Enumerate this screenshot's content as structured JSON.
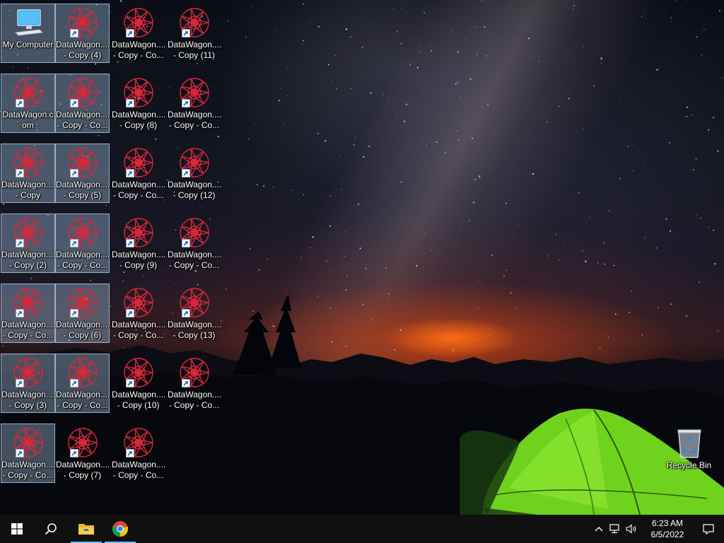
{
  "desktop": {
    "wallpaper": "night sky with milky way, sunset glow over mountains, illuminated green tent",
    "icons": [
      {
        "kind": "computer",
        "l1": "My Computer",
        "l2": "",
        "sel": true
      },
      {
        "kind": "datawagon",
        "l1": "DataWagon....",
        "l2": "- Copy (4)",
        "sel": true
      },
      {
        "kind": "datawagon",
        "l1": "DataWagon....",
        "l2": "- Copy - Co...",
        "sel": false
      },
      {
        "kind": "datawagon",
        "l1": "DataWagon....",
        "l2": "- Copy (11)",
        "sel": false
      },
      {
        "kind": "datawagon",
        "l1": "DataWagon.c",
        "l2": "om",
        "sel": true
      },
      {
        "kind": "datawagon",
        "l1": "DataWagon....",
        "l2": "- Copy - Co...",
        "sel": true
      },
      {
        "kind": "datawagon",
        "l1": "DataWagon....",
        "l2": "- Copy (8)",
        "sel": false
      },
      {
        "kind": "datawagon",
        "l1": "DataWagon....",
        "l2": "- Copy - Co...",
        "sel": false
      },
      {
        "kind": "datawagon",
        "l1": "DataWagon....",
        "l2": "- Copy",
        "sel": true
      },
      {
        "kind": "datawagon",
        "l1": "DataWagon....",
        "l2": "- Copy (5)",
        "sel": true
      },
      {
        "kind": "datawagon",
        "l1": "DataWagon....",
        "l2": "- Copy - Co...",
        "sel": false
      },
      {
        "kind": "datawagon",
        "l1": "DataWagon....",
        "l2": "- Copy (12)",
        "sel": false
      },
      {
        "kind": "datawagon",
        "l1": "DataWagon....",
        "l2": "- Copy (2)",
        "sel": true
      },
      {
        "kind": "datawagon",
        "l1": "DataWagon....",
        "l2": "- Copy - Co...",
        "sel": true
      },
      {
        "kind": "datawagon",
        "l1": "DataWagon....",
        "l2": "- Copy (9)",
        "sel": false
      },
      {
        "kind": "datawagon",
        "l1": "DataWagon....",
        "l2": "- Copy - Co...",
        "sel": false
      },
      {
        "kind": "datawagon",
        "l1": "DataWagon....",
        "l2": "- Copy - Co...",
        "sel": true
      },
      {
        "kind": "datawagon",
        "l1": "DataWagon....",
        "l2": "- Copy (6)",
        "sel": true
      },
      {
        "kind": "datawagon",
        "l1": "DataWagon....",
        "l2": "- Copy - Co...",
        "sel": false
      },
      {
        "kind": "datawagon",
        "l1": "DataWagon....",
        "l2": "- Copy (13)",
        "sel": false
      },
      {
        "kind": "datawagon",
        "l1": "DataWagon....",
        "l2": "- Copy (3)",
        "sel": true
      },
      {
        "kind": "datawagon",
        "l1": "DataWagon....",
        "l2": "- Copy - Co...",
        "sel": true
      },
      {
        "kind": "datawagon",
        "l1": "DataWagon....",
        "l2": "- Copy (10)",
        "sel": false
      },
      {
        "kind": "datawagon",
        "l1": "DataWagon....",
        "l2": "- Copy - Co...",
        "sel": false
      },
      {
        "kind": "datawagon",
        "l1": "DataWagon....",
        "l2": "- Copy - Co...",
        "sel": true
      },
      {
        "kind": "datawagon",
        "l1": "DataWagon....",
        "l2": "- Copy (7)",
        "sel": false
      },
      {
        "kind": "datawagon",
        "l1": "DataWagon....",
        "l2": "- Copy - Co...",
        "sel": false
      }
    ],
    "recycle_bin": {
      "label": "Recycle Bin"
    }
  },
  "taskbar": {
    "start": {
      "icon": "windows-logo-icon"
    },
    "search": {
      "icon": "search-icon"
    },
    "pinned": [
      {
        "name": "file-explorer",
        "icon": "folder-icon",
        "active": true
      },
      {
        "name": "google-chrome",
        "icon": "chrome-icon",
        "active": true
      }
    ],
    "tray": {
      "chevron": "chevron-up-icon",
      "network": "network-icon",
      "volume": "volume-icon",
      "time": "6:23 AM",
      "date": "6/5/2022",
      "notifications": "action-center-icon"
    }
  },
  "colors": {
    "taskbar_bg": "#101010",
    "active_indicator": "#76b9ed",
    "selection_bg": "#96b4d2",
    "datawagon_red": "#d8283a",
    "tent_green": "#7fe02a"
  }
}
